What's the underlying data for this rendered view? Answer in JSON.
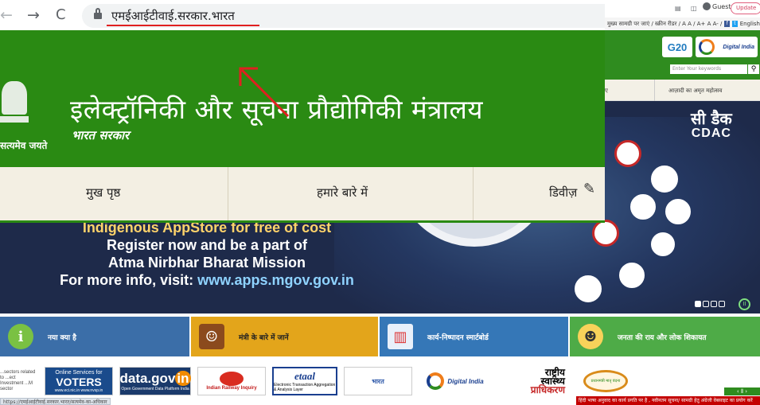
{
  "browser": {
    "url": "एमईआईटीवाई.सरकार.भारत",
    "guest_label": "Guest",
    "update_label": "Update"
  },
  "site_bg": {
    "topbar_text": "मुख्य सामग्री पर जाएं / स्क्रीन रीडर / A A / A+ A A- /",
    "english_label": "English",
    "search_placeholder": "Enter Your keywords",
    "g20_label": "G20",
    "digital_india_label": "Digital India",
    "nav_partial": "ए",
    "nav_amrit": "आज़ादी का अमृत महोत्सव",
    "cdac_hi": "सी डैक",
    "cdac_en": "CDAC"
  },
  "banner": {
    "line0": "Indigenous AppStore for free of cost",
    "line1": "Register now and be a part of",
    "line2": "Atma Nirbhar Bharat Mission",
    "line3_prefix": "For more info, visit: ",
    "line3_link": "www.apps.mgov.gov.in"
  },
  "tiles": [
    {
      "label": "नया क्या है",
      "icon": "info-icon"
    },
    {
      "label": "मंत्री के बारे में जानें",
      "icon": "minister-icon"
    },
    {
      "label": "कार्य-निष्पादन स्मार्टबोर्ड",
      "icon": "dashboard-icon"
    },
    {
      "label": "जनता की राय और लोक शिकायत",
      "icon": "people-icon"
    }
  ],
  "logos": {
    "a": "...sectors related to ...ect Investment ...M sector",
    "voters_small": "Online Services for",
    "voters_big": "VOTERS",
    "voters_url": "www.eci.nic.in  www.nvsp.in",
    "datagov": "data.gov",
    "datagov_badge": "in",
    "datagov_sub": "Open Government Data Platform India",
    "railway": "Indian Railway Inquiry",
    "etaal": "etaal",
    "etaal_sub": "Electronic Transaction Aggregation & Analysis Layer",
    "bharat": "भारत",
    "digital_india": "Digital India",
    "nha_line1": "राष्ट्रीय",
    "nha_line2": "स्वास्थ्य",
    "nha_line3": "प्राधिकरण",
    "pmmvy": "प्रधानमंत्री मातृ वंदना"
  },
  "status_url": "https://एमईआईटीवाई.सरकार.भारत/सत्यमेव-का-अधिकार",
  "ticker": "हिंदी भाषा अनुवाद का कार्य प्रगति पर है , नवीनतम सूचना/ सामग्री हेतु अंग्रेजी वेबसाइट का प्रयोग करें",
  "overlay": {
    "motto": "सत्यमेव जयते",
    "title": "इलेक्ट्रॉनिकी और सूचना प्रौद्योगिकी मंत्रालय",
    "subtitle": "भारत सरकार",
    "nav": [
      "मुख पृष्ठ",
      "हमारे बारे में",
      "डिवीज़"
    ]
  },
  "colors": {
    "ministry_green": "#2a8a13",
    "annotation_red": "#e02020"
  }
}
